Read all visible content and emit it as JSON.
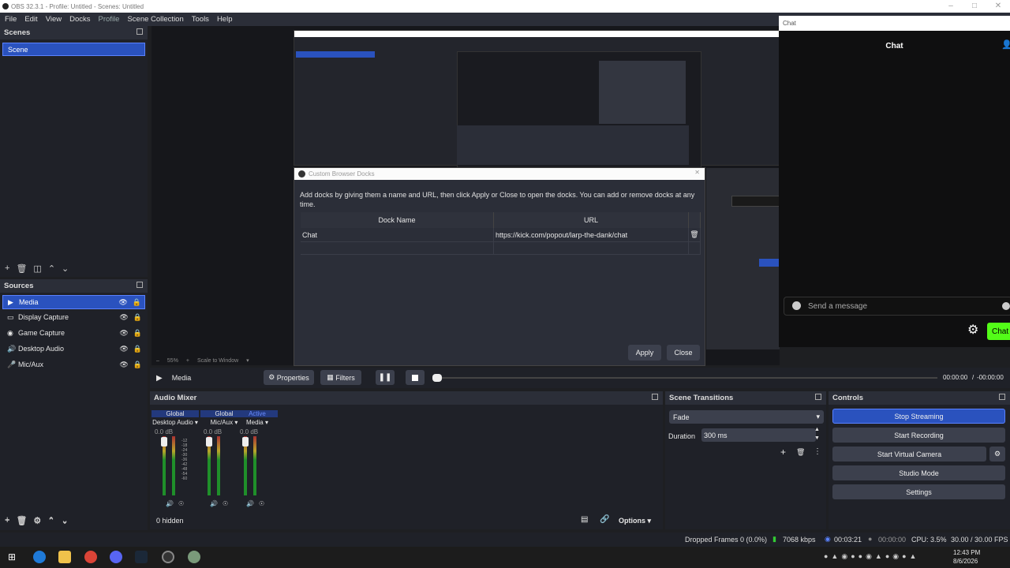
{
  "window": {
    "title": "OBS 32.3.1 - Profile: Untitled - Scenes: Untitled"
  },
  "menu": [
    "File",
    "Edit",
    "View",
    "Docks",
    "Profile",
    "Scene Collection",
    "Tools",
    "Help"
  ],
  "scenes": {
    "title": "Scenes",
    "items": [
      "Scene"
    ]
  },
  "sources": {
    "title": "Sources",
    "items": [
      {
        "label": "Media",
        "icon": "play-icon"
      },
      {
        "label": "Display Capture",
        "icon": "monitor-icon"
      },
      {
        "label": "Game Capture",
        "icon": "gamepad-icon"
      },
      {
        "label": "Desktop Audio",
        "icon": "speaker-icon"
      },
      {
        "label": "Mic/Aux",
        "icon": "mic-icon"
      }
    ]
  },
  "dialog": {
    "title": "Custom Browser Docks",
    "description": "Add docks by giving them a name and URL, then click Apply or Close to open the docks. You can add or remove docks at any time.",
    "col_name": "Dock Name",
    "col_url": "URL",
    "rows": [
      {
        "name": "Chat",
        "url": "https://kick.com/popout/larp-the-dank/chat"
      }
    ],
    "apply": "Apply",
    "close": "Close"
  },
  "chat": {
    "window_title": "Chat",
    "header": "Chat",
    "placeholder": "Send a message",
    "button": "Chat"
  },
  "preview": {
    "zoom": "55%",
    "scale": "Scale to Window"
  },
  "media": {
    "source": "Media",
    "properties": "Properties",
    "filters": "Filters",
    "time": "00:00:00",
    "sep": "/",
    "duration": "-00:00:00"
  },
  "mixer": {
    "title": "Audio Mixer",
    "channels": [
      {
        "tag": "Global",
        "name": "Desktop Audio",
        "db": "0.0 dB"
      },
      {
        "tag": "Global",
        "name": "Mic/Aux",
        "db": "0.0 dB"
      },
      {
        "tag": "Active",
        "name": "Media",
        "db": "0.0 dB"
      }
    ],
    "hidden": "0 hidden",
    "options": "Options",
    "scale": [
      "-12",
      "-18",
      "-24",
      "-30",
      "-36",
      "-42",
      "-48",
      "-54",
      "-60"
    ]
  },
  "transitions": {
    "title": "Scene Transitions",
    "type": "Fade",
    "duration_label": "Duration",
    "duration": "300 ms"
  },
  "controls": {
    "title": "Controls",
    "buttons": [
      "Stop Streaming",
      "Start Recording",
      "Start Virtual Camera",
      "Studio Mode",
      "Settings"
    ]
  },
  "status": {
    "dropped": "Dropped Frames 0 (0.0%)",
    "bitrate": "7068 kbps",
    "stream_time": "00:03:21",
    "rec_time": "00:00:00",
    "cpu": "CPU: 3.5%",
    "fps": "30.00 / 30.00 FPS"
  },
  "taskbar": {
    "time": "12:43 PM",
    "date": "8/6/2026"
  },
  "colors": {
    "accent": "#2a52be",
    "kick": "#53fc18"
  }
}
